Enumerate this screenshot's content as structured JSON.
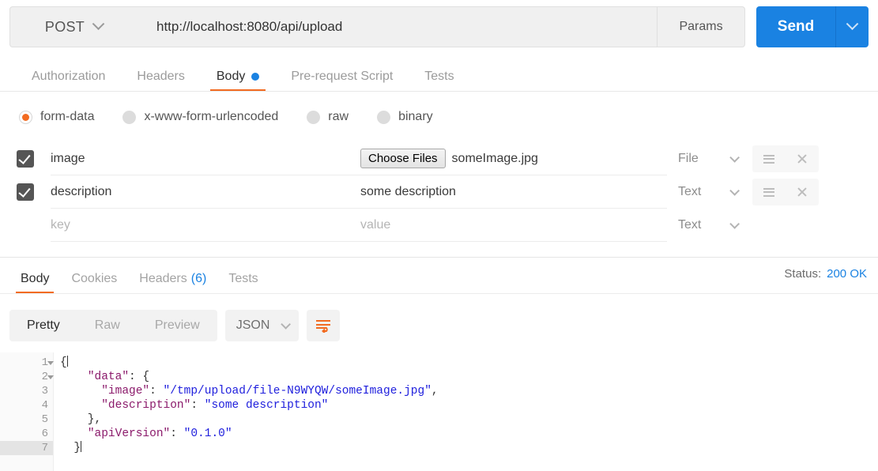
{
  "request": {
    "method": "POST",
    "url": "http://localhost:8080/api/upload",
    "params_label": "Params",
    "send_label": "Send",
    "tabs": [
      {
        "label": "Authorization",
        "active": false,
        "dot": false
      },
      {
        "label": "Headers",
        "active": false,
        "dot": false
      },
      {
        "label": "Body",
        "active": true,
        "dot": true
      },
      {
        "label": "Pre-request Script",
        "active": false,
        "dot": false
      },
      {
        "label": "Tests",
        "active": false,
        "dot": false
      }
    ],
    "body_types": [
      {
        "label": "form-data",
        "selected": true
      },
      {
        "label": "x-www-form-urlencoded",
        "selected": false
      },
      {
        "label": "raw",
        "selected": false
      },
      {
        "label": "binary",
        "selected": false
      }
    ],
    "form_rows": [
      {
        "checked": true,
        "key": "image",
        "key_placeholder": "key",
        "value_kind": "file",
        "choose_label": "Choose Files",
        "file_name": "someImage.jpg",
        "value": "",
        "value_placeholder": "value",
        "type": "File",
        "show_actions": true
      },
      {
        "checked": true,
        "key": "description",
        "key_placeholder": "key",
        "value_kind": "text",
        "choose_label": "Choose Files",
        "file_name": "",
        "value": "some description",
        "value_placeholder": "value",
        "type": "Text",
        "show_actions": true
      },
      {
        "checked": false,
        "key": "",
        "key_placeholder": "key",
        "value_kind": "text",
        "choose_label": "Choose Files",
        "file_name": "",
        "value": "",
        "value_placeholder": "value",
        "type": "Text",
        "show_actions": false
      }
    ]
  },
  "response": {
    "tabs": [
      {
        "label": "Body",
        "count": "",
        "active": true
      },
      {
        "label": "Cookies",
        "count": "",
        "active": false
      },
      {
        "label": "Headers",
        "count": "(6)",
        "active": false
      },
      {
        "label": "Tests",
        "count": "",
        "active": false
      }
    ],
    "status_label": "Status:",
    "status_value": "200 OK",
    "view_modes": [
      {
        "label": "Pretty",
        "active": true
      },
      {
        "label": "Raw",
        "active": false
      },
      {
        "label": "Preview",
        "active": false
      }
    ],
    "format": "JSON",
    "wrap_icon": "word-wrap-icon",
    "code_lines": [
      {
        "num": "1",
        "fold": true,
        "active": false,
        "tokens": [
          {
            "t": "{",
            "c": "p"
          }
        ]
      },
      {
        "num": "2",
        "fold": true,
        "active": false,
        "tokens": [
          {
            "t": "    ",
            "c": "p"
          },
          {
            "t": "\"data\"",
            "c": "k"
          },
          {
            "t": ": {",
            "c": "p"
          }
        ]
      },
      {
        "num": "3",
        "fold": false,
        "active": false,
        "tokens": [
          {
            "t": "      ",
            "c": "p"
          },
          {
            "t": "\"image\"",
            "c": "k"
          },
          {
            "t": ": ",
            "c": "p"
          },
          {
            "t": "\"/tmp/upload/file-N9WYQW/someImage.jpg\"",
            "c": "s"
          },
          {
            "t": ",",
            "c": "p"
          }
        ]
      },
      {
        "num": "4",
        "fold": false,
        "active": false,
        "tokens": [
          {
            "t": "      ",
            "c": "p"
          },
          {
            "t": "\"description\"",
            "c": "k"
          },
          {
            "t": ": ",
            "c": "p"
          },
          {
            "t": "\"some description\"",
            "c": "s"
          }
        ]
      },
      {
        "num": "5",
        "fold": false,
        "active": false,
        "tokens": [
          {
            "t": "    },",
            "c": "p"
          }
        ]
      },
      {
        "num": "6",
        "fold": false,
        "active": false,
        "tokens": [
          {
            "t": "    ",
            "c": "p"
          },
          {
            "t": "\"apiVersion\"",
            "c": "k"
          },
          {
            "t": ": ",
            "c": "p"
          },
          {
            "t": "\"0.1.0\"",
            "c": "s"
          }
        ]
      },
      {
        "num": "7",
        "fold": false,
        "active": true,
        "tokens": [
          {
            "t": "  }",
            "c": "p"
          }
        ]
      }
    ]
  },
  "colors": {
    "accent_orange": "#f26b21",
    "accent_blue": "#1a82e2",
    "json_key": "#8b1a6b",
    "json_string": "#2020dd"
  }
}
